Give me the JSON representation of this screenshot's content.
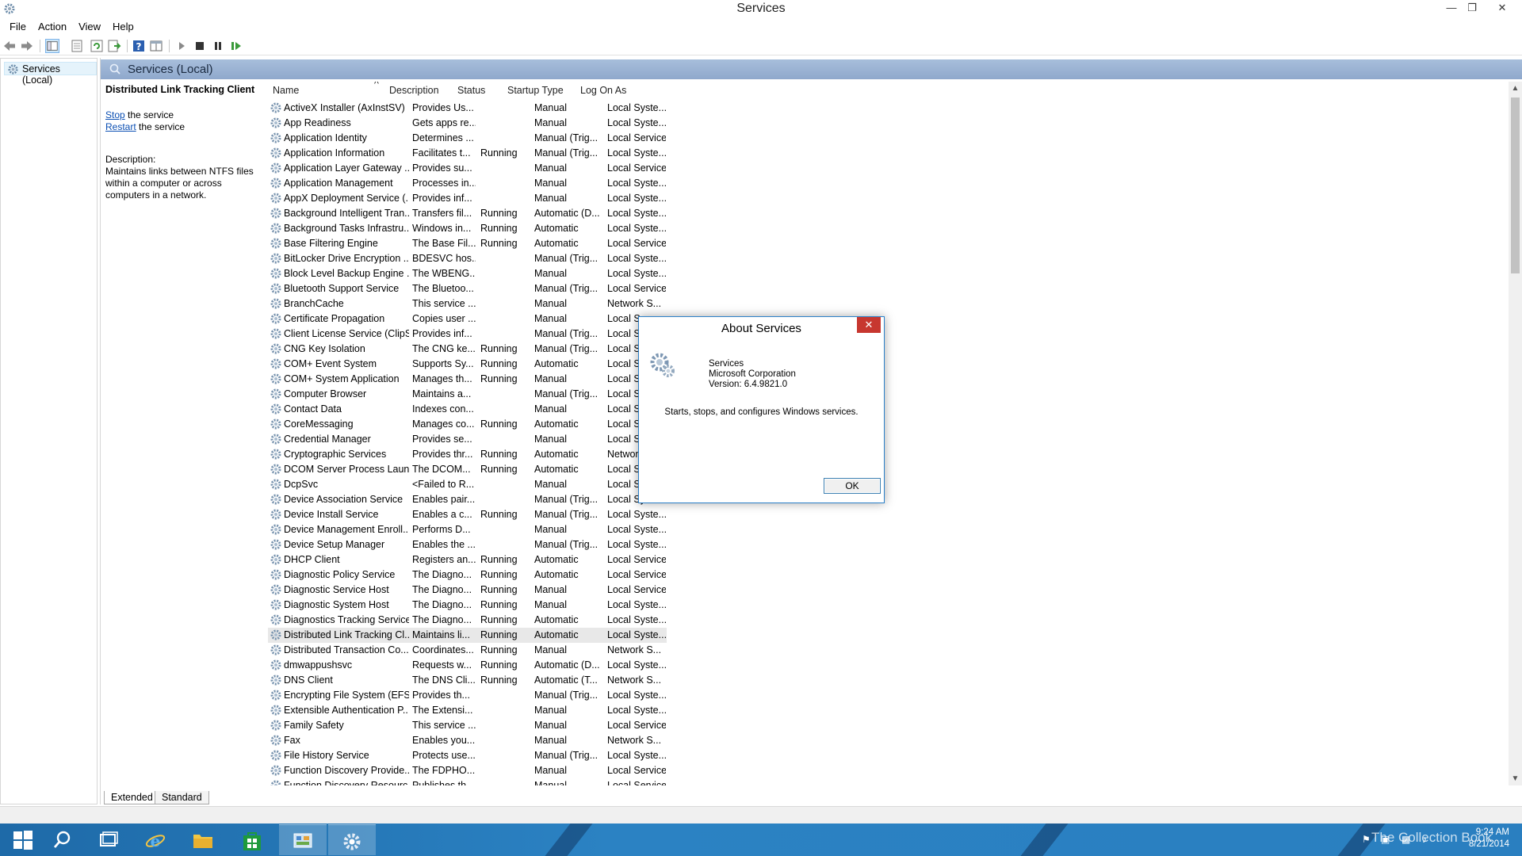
{
  "window": {
    "title": "Services"
  },
  "menu": [
    "File",
    "Action",
    "View",
    "Help"
  ],
  "tree": {
    "root_label": "Services (Local)"
  },
  "header": {
    "title": "Services (Local)"
  },
  "extended": {
    "service_name": "Distributed Link Tracking Client",
    "stop_link": "Stop",
    "stop_rest": " the service",
    "restart_link": "Restart",
    "restart_rest": " the service",
    "description_label": "Description:",
    "description": "Maintains links between NTFS files within a computer or across computers in a network."
  },
  "columns": [
    "Name",
    "Description",
    "Status",
    "Startup Type",
    "Log On As"
  ],
  "services": [
    [
      "ActiveX Installer (AxInstSV)",
      "Provides Us...",
      "",
      "Manual",
      "Local Syste..."
    ],
    [
      "App Readiness",
      "Gets apps re...",
      "",
      "Manual",
      "Local Syste..."
    ],
    [
      "Application Identity",
      "Determines ...",
      "",
      "Manual (Trig...",
      "Local Service"
    ],
    [
      "Application Information",
      "Facilitates t...",
      "Running",
      "Manual (Trig...",
      "Local Syste..."
    ],
    [
      "Application Layer Gateway ...",
      "Provides su...",
      "",
      "Manual",
      "Local Service"
    ],
    [
      "Application Management",
      "Processes in...",
      "",
      "Manual",
      "Local Syste..."
    ],
    [
      "AppX Deployment Service (...",
      "Provides inf...",
      "",
      "Manual",
      "Local Syste..."
    ],
    [
      "Background Intelligent Tran...",
      "Transfers fil...",
      "Running",
      "Automatic (D...",
      "Local Syste..."
    ],
    [
      "Background Tasks Infrastru...",
      "Windows in...",
      "Running",
      "Automatic",
      "Local Syste..."
    ],
    [
      "Base Filtering Engine",
      "The Base Fil...",
      "Running",
      "Automatic",
      "Local Service"
    ],
    [
      "BitLocker Drive Encryption ...",
      "BDESVC hos...",
      "",
      "Manual (Trig...",
      "Local Syste..."
    ],
    [
      "Block Level Backup Engine ...",
      "The WBENG...",
      "",
      "Manual",
      "Local Syste..."
    ],
    [
      "Bluetooth Support Service",
      "The Bluetoo...",
      "",
      "Manual (Trig...",
      "Local Service"
    ],
    [
      "BranchCache",
      "This service ...",
      "",
      "Manual",
      "Network S..."
    ],
    [
      "Certificate Propagation",
      "Copies user ...",
      "",
      "Manual",
      "Local Sy"
    ],
    [
      "Client License Service (ClipS...",
      "Provides inf...",
      "",
      "Manual (Trig...",
      "Local Sy"
    ],
    [
      "CNG Key Isolation",
      "The CNG ke...",
      "Running",
      "Manual (Trig...",
      "Local Sy"
    ],
    [
      "COM+ Event System",
      "Supports Sy...",
      "Running",
      "Automatic",
      "Local Se"
    ],
    [
      "COM+ System Application",
      "Manages th...",
      "Running",
      "Manual",
      "Local Sy"
    ],
    [
      "Computer Browser",
      "Maintains a...",
      "",
      "Manual (Trig...",
      "Local Sy"
    ],
    [
      "Contact Data",
      "Indexes con...",
      "",
      "Manual",
      "Local Sy"
    ],
    [
      "CoreMessaging",
      "Manages co...",
      "Running",
      "Automatic",
      "Local Se"
    ],
    [
      "Credential Manager",
      "Provides se...",
      "",
      "Manual",
      "Local Sy"
    ],
    [
      "Cryptographic Services",
      "Provides thr...",
      "Running",
      "Automatic",
      "Networ"
    ],
    [
      "DCOM Server Process Laun...",
      "The DCOM...",
      "Running",
      "Automatic",
      "Local Sy"
    ],
    [
      "DcpSvc",
      "<Failed to R...",
      "",
      "Manual",
      "Local Sy"
    ],
    [
      "Device Association Service",
      "Enables pair...",
      "",
      "Manual (Trig...",
      "Local Sy"
    ],
    [
      "Device Install Service",
      "Enables a c...",
      "Running",
      "Manual (Trig...",
      "Local Syste..."
    ],
    [
      "Device Management Enroll...",
      "Performs D...",
      "",
      "Manual",
      "Local Syste..."
    ],
    [
      "Device Setup Manager",
      "Enables the ...",
      "",
      "Manual (Trig...",
      "Local Syste..."
    ],
    [
      "DHCP Client",
      "Registers an...",
      "Running",
      "Automatic",
      "Local Service"
    ],
    [
      "Diagnostic Policy Service",
      "The Diagno...",
      "Running",
      "Automatic",
      "Local Service"
    ],
    [
      "Diagnostic Service Host",
      "The Diagno...",
      "Running",
      "Manual",
      "Local Service"
    ],
    [
      "Diagnostic System Host",
      "The Diagno...",
      "Running",
      "Manual",
      "Local Syste..."
    ],
    [
      "Diagnostics Tracking Service",
      "The Diagno...",
      "Running",
      "Automatic",
      "Local Syste..."
    ],
    [
      "Distributed Link Tracking Cl...",
      "Maintains li...",
      "Running",
      "Automatic",
      "Local Syste..."
    ],
    [
      "Distributed Transaction Co...",
      "Coordinates...",
      "Running",
      "Manual",
      "Network S..."
    ],
    [
      "dmwappushsvc",
      "Requests w...",
      "Running",
      "Automatic (D...",
      "Local Syste..."
    ],
    [
      "DNS Client",
      "The DNS Cli...",
      "Running",
      "Automatic (T...",
      "Network S..."
    ],
    [
      "Encrypting File System (EFS)",
      "Provides th...",
      "",
      "Manual (Trig...",
      "Local Syste..."
    ],
    [
      "Extensible Authentication P...",
      "The Extensi...",
      "",
      "Manual",
      "Local Syste..."
    ],
    [
      "Family Safety",
      "This service ...",
      "",
      "Manual",
      "Local Service"
    ],
    [
      "Fax",
      "Enables you...",
      "",
      "Manual",
      "Network S..."
    ],
    [
      "File History Service",
      "Protects use...",
      "",
      "Manual (Trig...",
      "Local Syste..."
    ],
    [
      "Function Discovery Provide...",
      "The FDPHO...",
      "",
      "Manual",
      "Local Service"
    ],
    [
      "Function Discovery Resourc...",
      "Publishes th...",
      "",
      "Manual",
      "Local Service"
    ]
  ],
  "selected_service": "Distributed Link Tracking Cl...",
  "tabs": [
    "Extended",
    "Standard"
  ],
  "dialog": {
    "title": "About Services",
    "product": "Services",
    "company": "Microsoft Corporation",
    "version": "Version: 6.4.9821.0",
    "summary": "Starts, stops, and configures Windows services.",
    "ok_label": "OK"
  },
  "taskbar": {
    "watermark": "The Collection Book",
    "time": "9:24 AM",
    "date": "8/21/2014"
  },
  "colors": {
    "header_blue": "#9bb3d4",
    "link_blue": "#0b4fb3",
    "taskbar_blue": "#2a7fc0",
    "close_red": "#c7372f"
  }
}
